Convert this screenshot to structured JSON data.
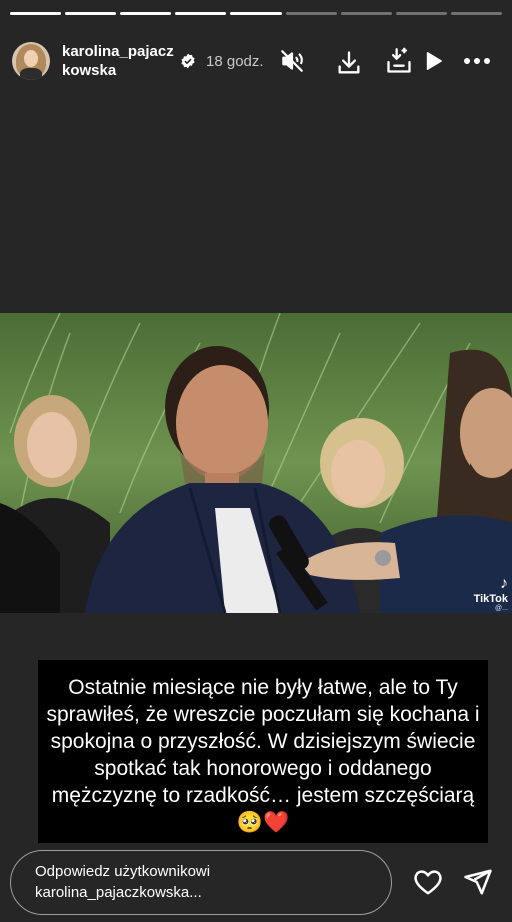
{
  "story": {
    "segments_total": 9,
    "segments_viewed": 5
  },
  "header": {
    "username": "karolina_pajaczkowska",
    "time": "18 godz.",
    "verified": true
  },
  "icons": {
    "mute": "speaker-muted-icon",
    "download": "download-icon",
    "save": "save-icon",
    "play": "play-icon",
    "more": "more-options-icon",
    "like": "heart-icon",
    "share": "send-icon"
  },
  "video": {
    "watermark": "TikTok",
    "watermark_handle": "@..."
  },
  "caption": {
    "text": "Ostatnie miesiące nie były łatwe, ale to Ty sprawiłeś, że wreszcie poczułam się kochana i spokojna o przyszłość. W dzisiejszym świecie spotkać tak honorowego i oddanego mężczyznę to rzadkość… jestem szczęściarą 🥺❤️"
  },
  "reply": {
    "line1": "Odpowiedz użytkownikowi",
    "line2": "karolina_pajaczkowska..."
  }
}
